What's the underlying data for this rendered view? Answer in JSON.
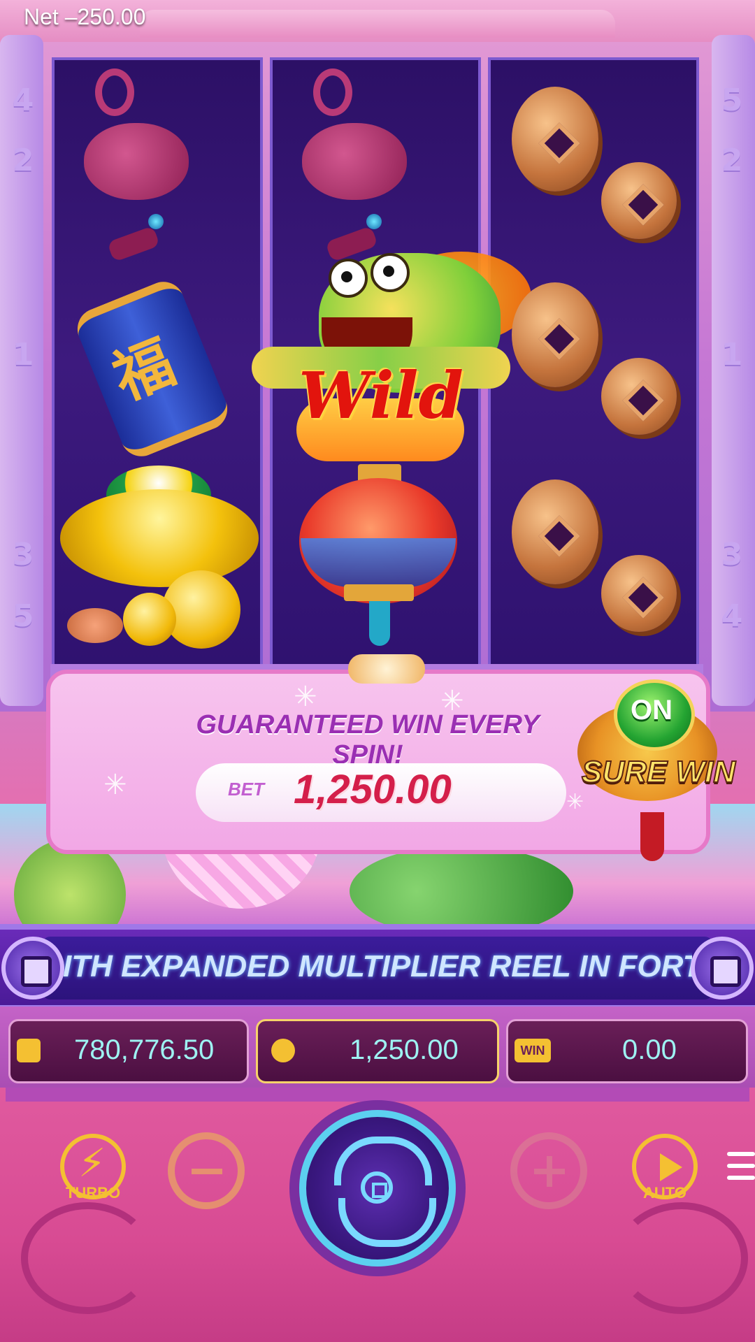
{
  "header": {
    "net_label": "Net",
    "net_value": "–250.00"
  },
  "paylines": {
    "left": [
      "4",
      "2",
      "1",
      "3",
      "5"
    ],
    "right": [
      "5",
      "2",
      "1",
      "3",
      "4"
    ]
  },
  "reels": [
    {
      "symbols": [
        "chinese-knot",
        "firecracker",
        "gold-ingot"
      ]
    },
    {
      "symbols": [
        "chinese-knot",
        "wild-dragon",
        "red-lantern"
      ]
    },
    {
      "symbols": [
        "copper-coins",
        "copper-coins",
        "copper-coins"
      ]
    }
  ],
  "wild_label": "Wild",
  "firecracker_char": "福",
  "banner": {
    "headline": "GUARANTEED WIN EVERY SPIN!",
    "bet_label": "BET",
    "bet_amount": "1,250.00"
  },
  "sure_win": {
    "state": "ON",
    "label": "SURE WIN"
  },
  "ticker": {
    "text": "ITH EXPANDED MULTIPLIER REEL IN FORTUNE DR"
  },
  "info": {
    "balance": "780,776.50",
    "bet": "1,250.00",
    "win_icon_label": "WIN",
    "win": "0.00"
  },
  "controls": {
    "turbo_label": "TURBO",
    "auto_label": "AUTO"
  },
  "colors": {
    "accent_gold": "#f4c032",
    "bet_red": "#d41f4a",
    "info_cyan": "#9ef2f2"
  }
}
